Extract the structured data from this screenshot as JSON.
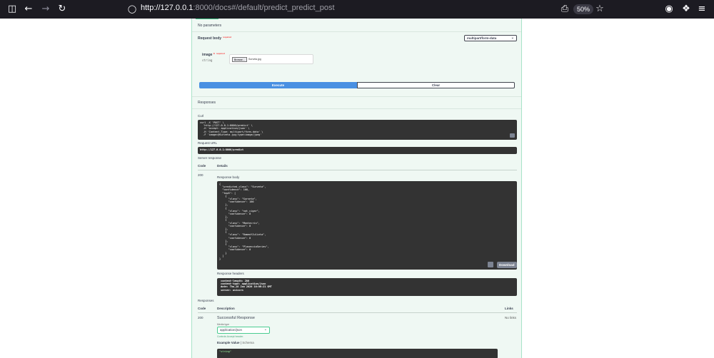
{
  "browser": {
    "url_host": "http://127.0.0.1",
    "url_rest": ":8000/docs#/default/predict_predict_post",
    "zoom": "50%"
  },
  "operation": {
    "no_parameters": "No parameters",
    "request_body_label": "Request body",
    "required_label": "required",
    "content_type": "multipart/form-data",
    "field_name": "image",
    "field_required_mark": "*",
    "field_type": "string",
    "browse_label": "Browse...",
    "file_name": "Surveta.jpg",
    "execute_label": "Execute",
    "clear_label": "Clear",
    "responses_heading": "Responses",
    "curl_label": "Curl",
    "curl_lines": [
      "curl -X 'POST' \\",
      "  'http://127.0.0.1:8000/predict' \\",
      "  -H 'accept: application/json' \\",
      "  -H 'Content-Type: multipart/form-data' \\",
      "  -F 'image=@Surveta.jpg;type=image/jpeg'"
    ],
    "request_url_label": "Request URL",
    "request_url": "http://127.0.0.1:8000/predict",
    "server_response_label": "Server response",
    "code_header": "Code",
    "details_header": "Details",
    "response_code": "200",
    "response_body_label": "Response body",
    "response_body_lines": [
      "{",
      "  \"predicted_class\": \"Surveta\",",
      "  \"confidence\": 100,",
      "  \"top5\": [",
      "    {",
      "      \"class\": \"Surveta\",",
      "      \"confidence\": 100",
      "    },",
      "    {",
      "      \"class\": \"not_cigar\",",
      "      \"confidence\": 0",
      "    },",
      "    {",
      "      \"class\": \"Montecris\",",
      "      \"confidence\": 0",
      "    },",
      "    {",
      "      \"class\": \"RomeoYJulieta\",",
      "      \"confidence\": 0",
      "    },",
      "    {",
      "      \"class\": \"PlasencioSeries\",",
      "      \"confidence\": 0",
      "    }",
      "  ]",
      "}"
    ],
    "download_label": "Download",
    "response_headers_label": "Response headers",
    "response_headers_lines": [
      " content-length: 286",
      " content-type: application/json",
      " date: Thu,18 Jan 2026 10:06:21 GMT",
      " server: uvicorn"
    ],
    "responses_label": "Responses",
    "description_header": "Description",
    "links_header": "Links",
    "doc_code": "200",
    "doc_description": "Successful Response",
    "no_links": "No links",
    "media_type_label": "Media type",
    "media_type": "application/json",
    "controls_accept": "Controls Accept header.",
    "example_value_label": "Example Value",
    "schema_label": "Schema",
    "example_value": "\"string\""
  }
}
